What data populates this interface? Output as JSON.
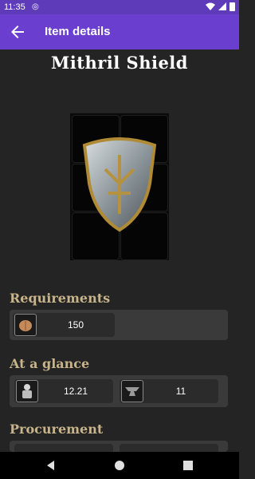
{
  "status_bar": {
    "time": "11:35"
  },
  "app_bar": {
    "title": "Item details"
  },
  "item": {
    "name": "Mithril Shield"
  },
  "sections": {
    "requirements": {
      "title": "Requirements",
      "stats": [
        {
          "icon": "strength-torso-icon",
          "value": "150"
        }
      ]
    },
    "at_a_glance": {
      "title": "At a glance",
      "stats": [
        {
          "icon": "armor-knight-icon",
          "value": "12.21"
        },
        {
          "icon": "anvil-icon",
          "value": "11"
        }
      ]
    },
    "procurement": {
      "title": "Procurement"
    }
  },
  "colors": {
    "accent": "#6a3fd0",
    "section_title": "#c8b48a",
    "background": "#242424"
  }
}
